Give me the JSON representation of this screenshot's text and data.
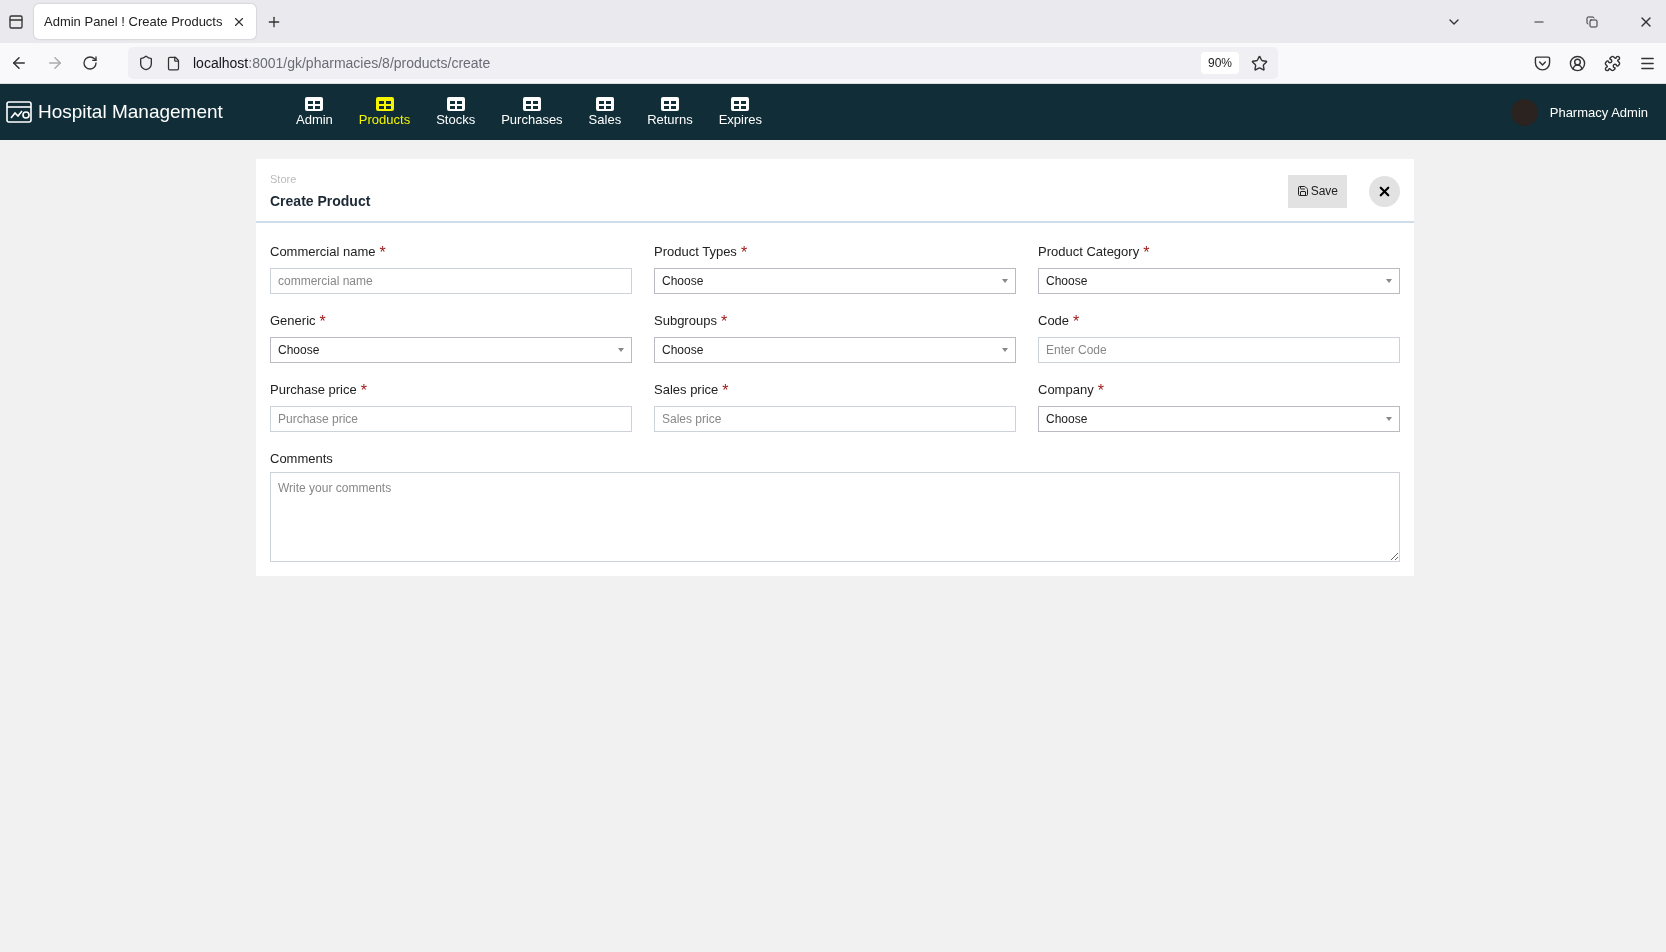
{
  "browser": {
    "tab_title": "Admin Panel ! Create Products",
    "url_host": "localhost",
    "url_path": ":8001/gk/pharmacies/8/products/create",
    "zoom": "90%"
  },
  "navbar": {
    "brand": "Hospital Management",
    "user": "Pharmacy Admin",
    "items": [
      {
        "label": "Admin",
        "selected": false
      },
      {
        "label": "Products",
        "selected": true
      },
      {
        "label": "Stocks",
        "selected": false
      },
      {
        "label": "Purchases",
        "selected": false
      },
      {
        "label": "Sales",
        "selected": false
      },
      {
        "label": "Returns",
        "selected": false
      },
      {
        "label": "Expires",
        "selected": false
      }
    ]
  },
  "card": {
    "breadcrumb": "Store",
    "title": "Create Product",
    "save_label": "Save"
  },
  "fields": [
    {
      "kind": "text",
      "label": "Commercial name",
      "required_mark": "*",
      "placeholder": "commercial name"
    },
    {
      "kind": "select",
      "label": "Product Types",
      "required_mark": "*",
      "value": "Choose"
    },
    {
      "kind": "select",
      "label": "Product Category",
      "required_mark": "*",
      "value": "Choose"
    },
    {
      "kind": "select",
      "label": "Generic",
      "required_mark": "*",
      "value": "Choose"
    },
    {
      "kind": "select",
      "label": "Subgroups",
      "required_mark": "*",
      "value": "Choose"
    },
    {
      "kind": "text",
      "label": "Code",
      "required_mark": "*",
      "placeholder": "Enter Code"
    },
    {
      "kind": "text",
      "label": "Purchase price",
      "required_mark": "*",
      "placeholder": "Purchase price"
    },
    {
      "kind": "text",
      "label": "Sales price",
      "required_mark": "*",
      "placeholder": "Sales price"
    },
    {
      "kind": "select",
      "label": "Company",
      "required_mark": "*",
      "value": "Choose"
    },
    {
      "kind": "textarea",
      "label": "Comments",
      "placeholder": "Write your comments"
    }
  ]
}
